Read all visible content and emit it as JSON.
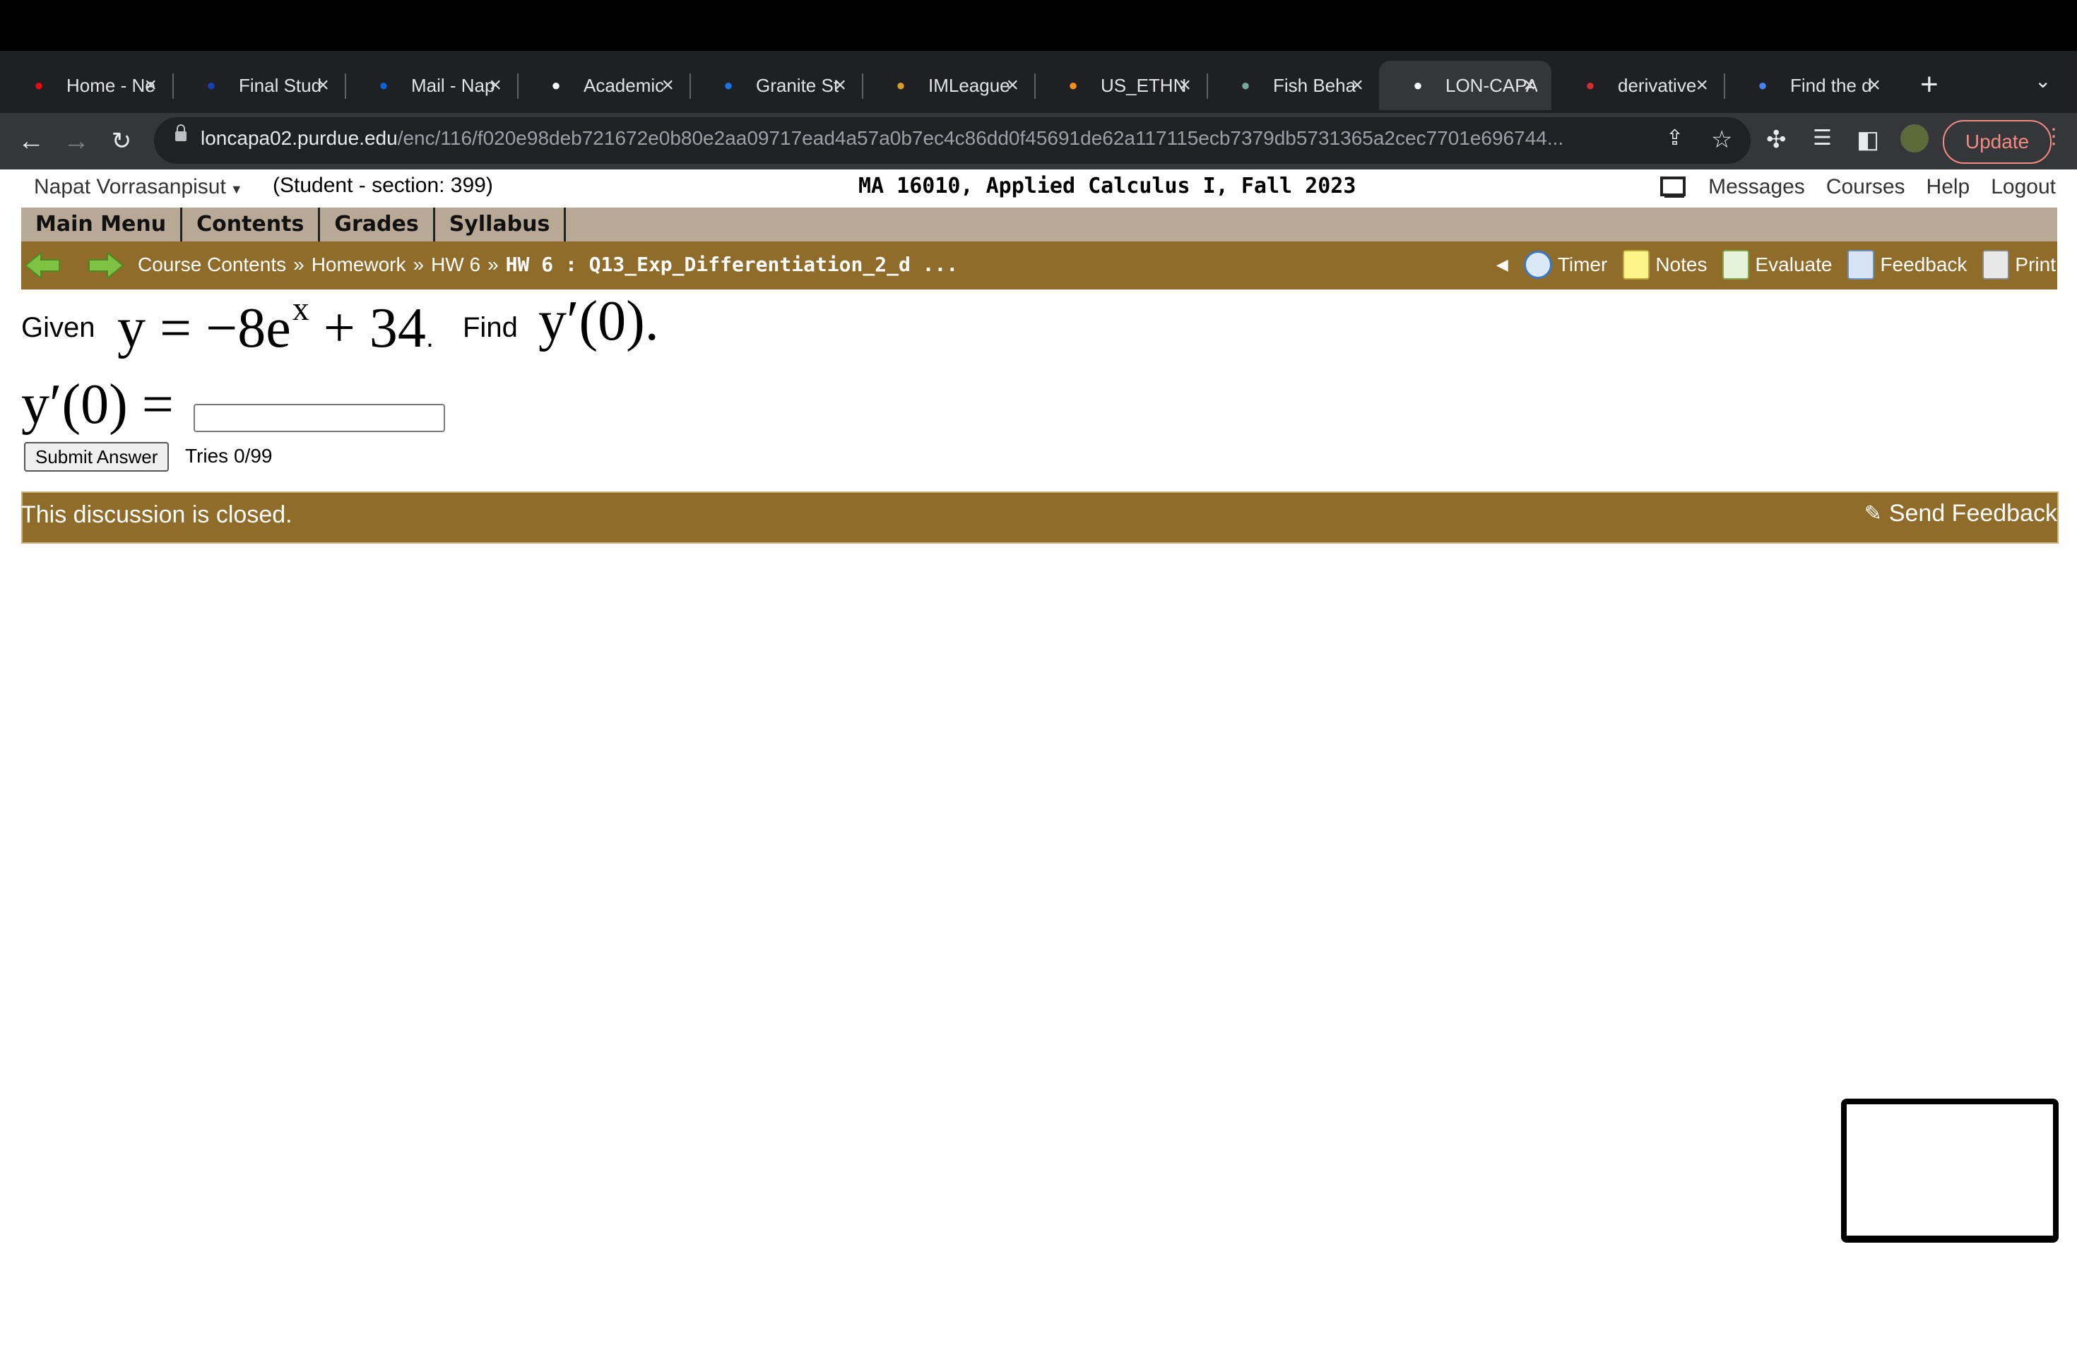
{
  "browser": {
    "tabs": [
      {
        "title": "Home - Ne",
        "icon": "netflix-icon",
        "color": "#e50914"
      },
      {
        "title": "Final Stud",
        "icon": "star-icon",
        "color": "#1a3fb5"
      },
      {
        "title": "Mail - Nap",
        "icon": "outlook-icon",
        "color": "#0a64d4"
      },
      {
        "title": "Academic",
        "icon": "ahp-icon",
        "color": "#ffffff"
      },
      {
        "title": "Granite St",
        "icon": "granite-icon",
        "color": "#1a73e8"
      },
      {
        "title": "IMLeague",
        "icon": "imleagues-icon",
        "color": "#d89b2b"
      },
      {
        "title": "US_ETHN",
        "icon": "bitcoin-icon",
        "color": "#f7931a"
      },
      {
        "title": "Fish Beha",
        "icon": "openai-icon",
        "color": "#74aa9c"
      },
      {
        "title": "LON-CAPA",
        "icon": "loncapa-icon",
        "color": "#ffffff"
      },
      {
        "title": "derivative",
        "icon": "symbolab-icon",
        "color": "#d32f2f"
      },
      {
        "title": "Find the d",
        "icon": "google-icon",
        "color": "#4285f4"
      }
    ],
    "url_host": "loncapa02.purdue.edu",
    "url_path": "/enc/116/f020e98deb721672e0b80e2aa09717ead4a57a0b7ec4c86dd0f45691de62a117115ecb7379db5731365a2cec7701e696744...",
    "update_label": "Update"
  },
  "header": {
    "user_name": "Napat Vorrasanpisut",
    "role_section": "(Student  - section: 399)",
    "course_title": "MA 16010, Applied Calculus I, Fall 2023",
    "links": [
      "Messages",
      "Courses",
      "Help",
      "Logout"
    ]
  },
  "menu": {
    "items": [
      "Main Menu",
      "Contents",
      "Grades",
      "Syllabus"
    ]
  },
  "breadcrumb": {
    "items": [
      "Course Contents",
      "Homework",
      "HW 6"
    ],
    "current": "HW 6 : Q13_Exp_Differentiation_2_d ...",
    "separator": "»"
  },
  "tools": {
    "timer": "Timer",
    "notes": "Notes",
    "evaluate": "Evaluate",
    "feedback": "Feedback",
    "print": "Print"
  },
  "question": {
    "given_label": "Given",
    "equation_main": "y = −8e",
    "equation_exp": "x",
    "equation_tail": " + 34",
    "period": ".",
    "find_label": "Find",
    "find_expr": "y′(0).",
    "answer_label": "y′(0) =",
    "answer_value": "",
    "submit_label": "Submit Answer",
    "tries": "Tries 0/99"
  },
  "discussion": {
    "status": "This discussion is closed.",
    "send_feedback": "Send Feedback"
  },
  "colors": {
    "bar_gold": "#8f6c2a",
    "menu_tan": "#b8a896"
  }
}
